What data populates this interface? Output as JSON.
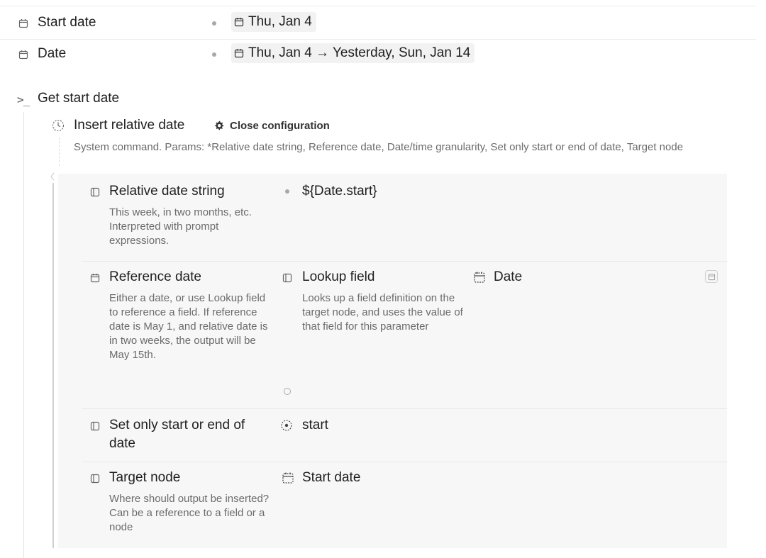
{
  "fields": [
    {
      "icon": "calendar-icon",
      "name": "Start date",
      "value": "Thu, Jan 4"
    },
    {
      "icon": "calendar-icon",
      "name": "Date",
      "value": "Thu, Jan 4 → Yesterday, Sun, Jan 14"
    }
  ],
  "command": {
    "prompt_symbol": ">_",
    "title": "Get start date",
    "insert": {
      "title": "Insert relative date",
      "close_label": "Close configuration",
      "description": "System command. Params: *Relative date string, Reference date, Date/time granularity, Set only start or end of date, Target node"
    }
  },
  "params": {
    "relative": {
      "name": "Relative date string",
      "desc": "This week, in two months, etc. Interpreted with prompt expressions.",
      "value": "${Date.start}"
    },
    "reference": {
      "name": "Reference date",
      "desc": "Either a date, or use Lookup field to reference a field. If reference date is May 1, and relative date is in two weeks, the output will be May 15th.",
      "lookup_name": "Lookup field",
      "lookup_desc": "Looks up a field definition on the target node, and uses the value of that field for this parameter",
      "lookup_value": "Date"
    },
    "set_only": {
      "name": "Set only start or end of date",
      "value": "start"
    },
    "target": {
      "name": "Target node",
      "desc": "Where should output be inserted? Can be a reference to a field or a node",
      "value": "Start date"
    }
  },
  "colors": {
    "panel_bg": "#f7f7f7",
    "text": "#1f1f1f",
    "muted": "#6b6b6b"
  }
}
